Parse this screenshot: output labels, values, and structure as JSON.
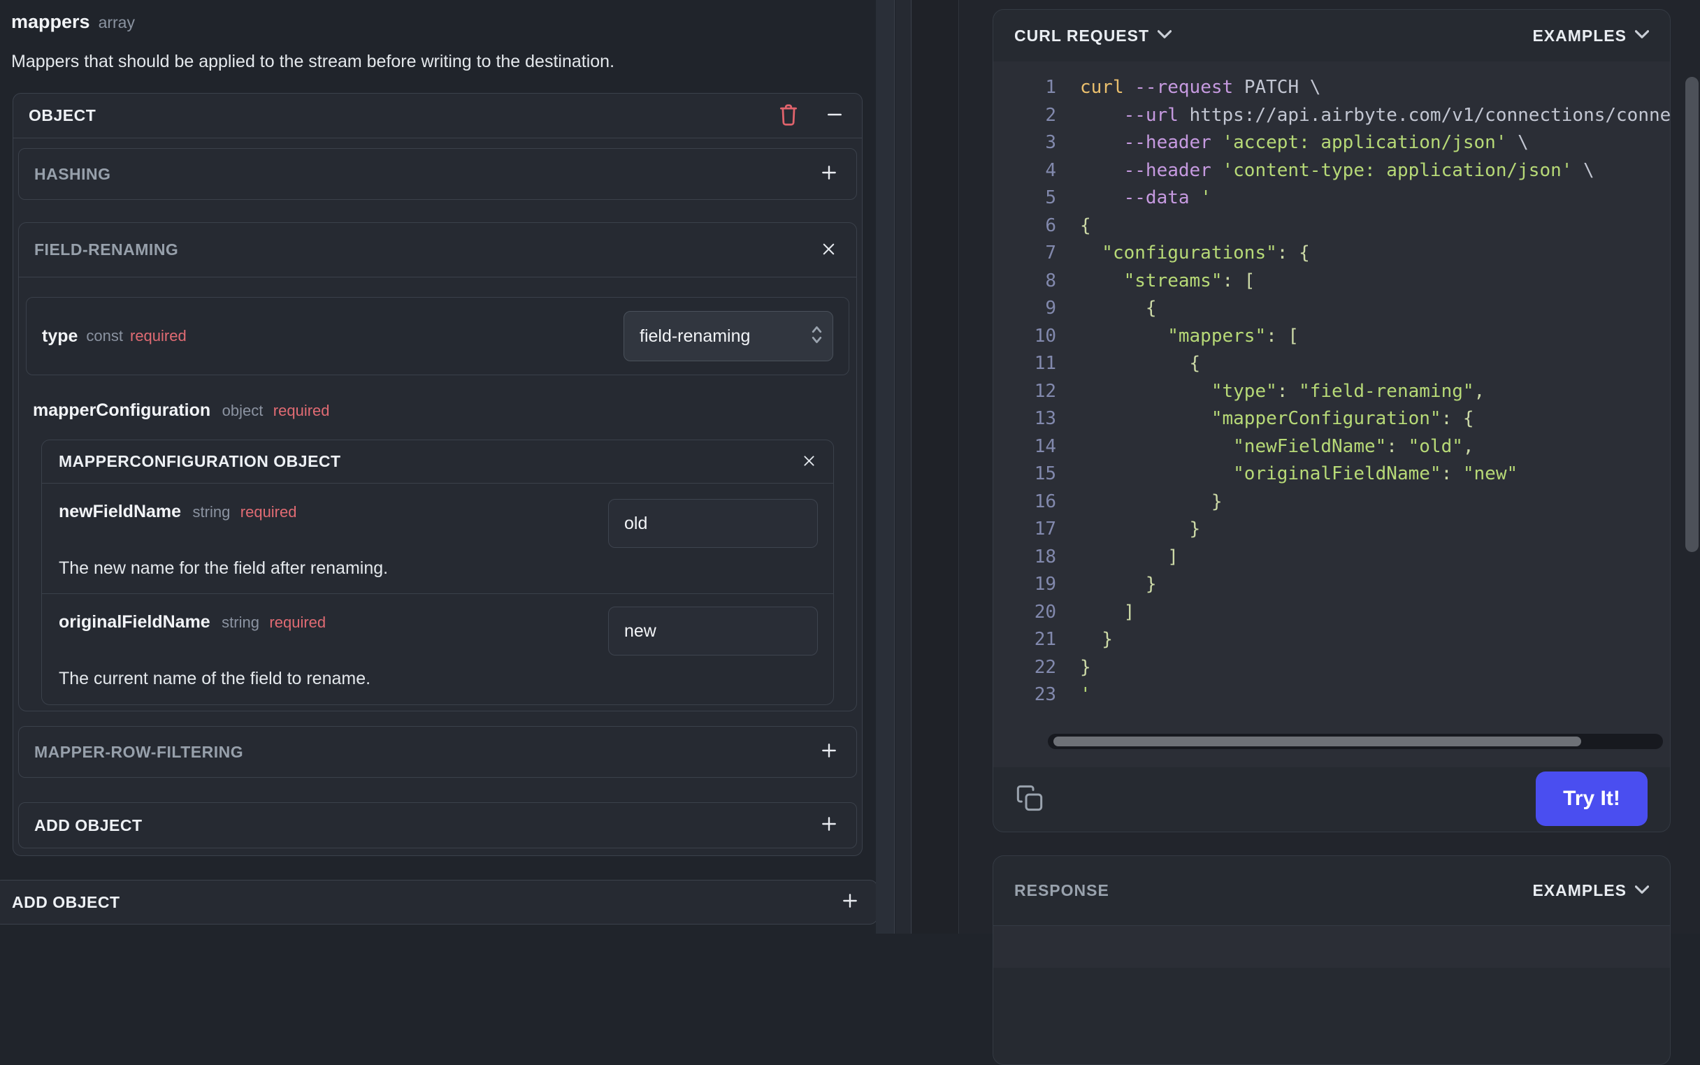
{
  "left_panel": {
    "title": "mappers",
    "title_type": "array",
    "description": "Mappers that should be applied to the stream before writing to the destination.",
    "object_card": {
      "header": "OBJECT",
      "hashing": {
        "label": "HASHING"
      },
      "field_renaming": {
        "label": "FIELD-RENAMING",
        "type_field": {
          "name": "type",
          "kind": "const",
          "required": "required",
          "value": "field-renaming"
        },
        "mapper_configuration": {
          "name": "mapperConfiguration",
          "kind": "object",
          "required": "required",
          "card_header": "MAPPERCONFIGURATION OBJECT",
          "fields": [
            {
              "name": "newFieldName",
              "kind": "string",
              "required": "required",
              "value": "old",
              "description": "The new name for the field after renaming."
            },
            {
              "name": "originalFieldName",
              "kind": "string",
              "required": "required",
              "value": "new",
              "description": "The current name of the field to rename."
            }
          ]
        }
      },
      "mapper_row_filtering": {
        "label": "MAPPER-ROW-FILTERING"
      },
      "add_object": {
        "label": "ADD OBJECT"
      }
    },
    "add_object_outer": {
      "label": "ADD OBJECT"
    }
  },
  "right_panel": {
    "curl_request": {
      "title": "CURL REQUEST",
      "examples_label": "EXAMPLES",
      "try_it_label": "Try It!",
      "code": {
        "lines": [
          {
            "n": "1",
            "segs": [
              [
                "kw",
                "curl"
              ],
              [
                "flag",
                " --request"
              ],
              [
                "plain",
                " PATCH \\"
              ]
            ]
          },
          {
            "n": "2",
            "segs": [
              [
                "flag",
                "    --url"
              ],
              [
                "plain",
                " https://api.airbyte.com/v1/connections/conne"
              ]
            ]
          },
          {
            "n": "3",
            "segs": [
              [
                "flag",
                "    --header"
              ],
              [
                "str",
                " 'accept: application/json'"
              ],
              [
                "plain",
                " \\"
              ]
            ]
          },
          {
            "n": "4",
            "segs": [
              [
                "flag",
                "    --header"
              ],
              [
                "str",
                " 'content-type: application/json'"
              ],
              [
                "plain",
                " \\"
              ]
            ]
          },
          {
            "n": "5",
            "segs": [
              [
                "flag",
                "    --data"
              ],
              [
                "str",
                " '"
              ]
            ]
          },
          {
            "n": "6",
            "segs": [
              [
                "pale",
                "{"
              ]
            ]
          },
          {
            "n": "7",
            "segs": [
              [
                "str",
                "  \"configurations\""
              ],
              [
                "pale",
                ": {"
              ]
            ]
          },
          {
            "n": "8",
            "segs": [
              [
                "str",
                "    \"streams\""
              ],
              [
                "pale",
                ": ["
              ]
            ]
          },
          {
            "n": "9",
            "segs": [
              [
                "pale",
                "      {"
              ]
            ]
          },
          {
            "n": "10",
            "segs": [
              [
                "str",
                "        \"mappers\""
              ],
              [
                "pale",
                ": ["
              ]
            ]
          },
          {
            "n": "11",
            "segs": [
              [
                "pale",
                "          {"
              ]
            ]
          },
          {
            "n": "12",
            "segs": [
              [
                "str",
                "            \"type\""
              ],
              [
                "pale",
                ": "
              ],
              [
                "str",
                "\"field-renaming\""
              ],
              [
                "pale",
                ","
              ]
            ]
          },
          {
            "n": "13",
            "segs": [
              [
                "str",
                "            \"mapperConfiguration\""
              ],
              [
                "pale",
                ": {"
              ]
            ]
          },
          {
            "n": "14",
            "segs": [
              [
                "str",
                "              \"newFieldName\""
              ],
              [
                "pale",
                ": "
              ],
              [
                "str",
                "\"old\""
              ],
              [
                "pale",
                ","
              ]
            ]
          },
          {
            "n": "15",
            "segs": [
              [
                "str",
                "              \"originalFieldName\""
              ],
              [
                "pale",
                ": "
              ],
              [
                "str",
                "\"new\""
              ]
            ]
          },
          {
            "n": "16",
            "segs": [
              [
                "pale",
                "            }"
              ]
            ]
          },
          {
            "n": "17",
            "segs": [
              [
                "pale",
                "          }"
              ]
            ]
          },
          {
            "n": "18",
            "segs": [
              [
                "pale",
                "        ]"
              ]
            ]
          },
          {
            "n": "19",
            "segs": [
              [
                "pale",
                "      }"
              ]
            ]
          },
          {
            "n": "20",
            "segs": [
              [
                "pale",
                "    ]"
              ]
            ]
          },
          {
            "n": "21",
            "segs": [
              [
                "pale",
                "  }"
              ]
            ]
          },
          {
            "n": "22",
            "segs": [
              [
                "pale",
                "}"
              ]
            ]
          },
          {
            "n": "23",
            "segs": [
              [
                "str",
                "'"
              ]
            ]
          }
        ]
      }
    },
    "response": {
      "title": "RESPONSE",
      "examples_label": "EXAMPLES"
    }
  },
  "colors": {
    "accent_button": "#4a4ef0",
    "danger": "#e0636c",
    "code_keyword": "#eabf6d",
    "code_flag": "#c69ae0",
    "code_plain": "#c2c6d2",
    "code_string": "#b7d977",
    "code_punct": "#ccd9a6",
    "required_text": "#e06b73"
  }
}
